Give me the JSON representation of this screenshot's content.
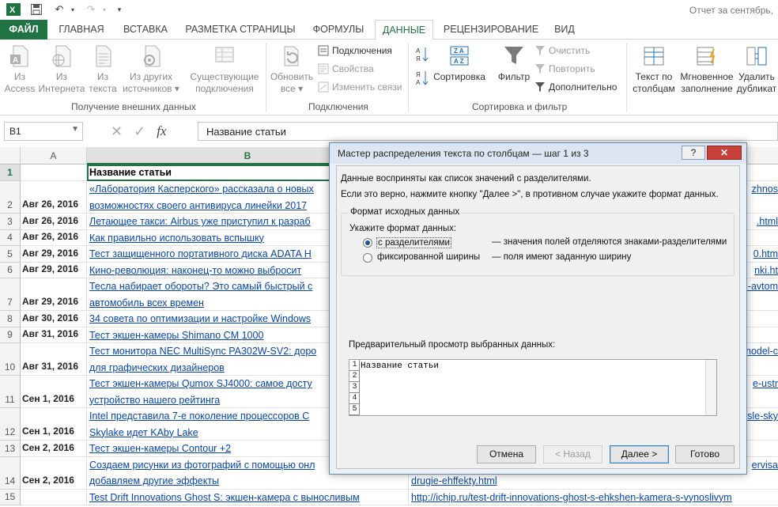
{
  "title_bar": {
    "doc_title": "Отчет за сентябрь,"
  },
  "tabs": [
    {
      "label": "ФАЙЛ"
    },
    {
      "label": "ГЛАВНАЯ"
    },
    {
      "label": "ВСТАВКА"
    },
    {
      "label": "РАЗМЕТКА СТРАНИЦЫ"
    },
    {
      "label": "ФОРМУЛЫ"
    },
    {
      "label": "ДАННЫЕ"
    },
    {
      "label": "РЕЦЕНЗИРОВАНИЕ"
    },
    {
      "label": "ВИД"
    }
  ],
  "ribbon": {
    "external": {
      "access": [
        "Из",
        "Access"
      ],
      "web": [
        "Из",
        "Интернета"
      ],
      "text": [
        "Из",
        "текста"
      ],
      "other": [
        "Из других",
        "источников ▾"
      ],
      "existing": [
        "Существующие",
        "подключения"
      ],
      "group_label": "Получение внешних данных"
    },
    "connections": {
      "refresh": [
        "Обновить",
        "все ▾"
      ],
      "conn": "Подключения",
      "props": "Свойства",
      "edit_links": "Изменить связи",
      "group_label": "Подключения"
    },
    "sort_filter": {
      "sort": "Сортировка",
      "filter": "Фильтр",
      "clear": "Очистить",
      "reapply": "Повторить",
      "advanced": "Дополнительно",
      "group_label": "Сортировка и фильтр"
    },
    "tools": {
      "text_to_cols": [
        "Текст по",
        "столбцам"
      ],
      "flash_fill": [
        "Мгновенное",
        "заполнение"
      ],
      "remove_dup": [
        "Удалить",
        "дубликат"
      ]
    }
  },
  "formula_bar": {
    "name_box": "B1",
    "fx": "fx",
    "content": "Название статьи"
  },
  "grid": {
    "columns": [
      "A",
      "B"
    ],
    "rows": [
      {
        "num": "1",
        "date": "",
        "title": [
          "Название статьи"
        ],
        "url": [
          ""
        ]
      },
      {
        "num": "2",
        "date": "Авг 26, 2016",
        "title": [
          "«Лаборатория Касперского» рассказала о новых",
          "возможностях своего антивируса линейки 2017"
        ],
        "url": [
          "zhnos",
          ""
        ]
      },
      {
        "num": "3",
        "date": "Авг 26, 2016",
        "title": [
          "Летающее такси: Airbus уже приступил к разраб"
        ],
        "url": [
          ".html"
        ]
      },
      {
        "num": "4",
        "date": "Авг 26, 2016",
        "title": [
          "Как правильно использовать вспышку"
        ],
        "url": [
          ""
        ]
      },
      {
        "num": "5",
        "date": "Авг 29, 2016",
        "title": [
          "Тест защищенного портативного диска ADATA H"
        ],
        "url": [
          "0.htm"
        ]
      },
      {
        "num": "6",
        "date": "Авг 29, 2016",
        "title": [
          "Кино-революция: наконец-то можно выбросит"
        ],
        "url": [
          "nki.ht"
        ]
      },
      {
        "num": "7",
        "date": "Авг 29, 2016",
        "title": [
          "Тесла набирает обороты? Это самый быстрый с",
          "автомобиль всех времен"
        ],
        "url": [
          "ki-avtom",
          ""
        ]
      },
      {
        "num": "8",
        "date": "Авг 30, 2016",
        "title": [
          "34 совета по оптимизации и настройке Windows"
        ],
        "url": [
          ""
        ]
      },
      {
        "num": "9",
        "date": "Авг 31, 2016",
        "title": [
          "Тест экшен-камеры Shimano CM 1000"
        ],
        "url": [
          ""
        ]
      },
      {
        "num": "10",
        "date": "Авг 31, 2016",
        "title": [
          "Тест монитора NEC MultiSync PA302W-SV2: доро",
          "для графических дизайнеров"
        ],
        "url": [
          "model-c",
          ""
        ]
      },
      {
        "num": "11",
        "date": "Сен 1, 2016",
        "title": [
          "Тест экшен-камеры Qumox SJ4000: самое досту",
          "устройство нашего рейтинга"
        ],
        "url": [
          "e-ustr",
          ""
        ]
      },
      {
        "num": "12",
        "date": "Сен 1, 2016",
        "title": [
          "Intel представила 7-е поколение процессоров С",
          "Skylake идет KAby Lake"
        ],
        "url": [
          "sle-sky",
          ""
        ]
      },
      {
        "num": "13",
        "date": "Сен 2, 2016",
        "title": [
          "Тест экшен-камеры Contour +2"
        ],
        "url": [
          ""
        ]
      },
      {
        "num": "14",
        "date": "Сен 2, 2016",
        "title": [
          "Создаем рисунки из фотографий с помощью онл",
          "добавляем другие эффекты"
        ],
        "url": [
          "ervisa",
          "drugie-ehffekty.html"
        ]
      },
      {
        "num": "15",
        "date": "",
        "title": [
          "Test Drift Innovations Ghost S: экшен-камера с выносливым"
        ],
        "url": [
          "http://ichip.ru/test-drift-innovations-ghost-s-ehkshen-kamera-s-vynoslivym"
        ]
      }
    ]
  },
  "dialog": {
    "title": "Мастер распределения текста по столбцам — шаг 1 из 3",
    "help": "?",
    "close": "✕",
    "line1": "Данные восприняты как список значений с разделителями.",
    "line2": "Если это верно, нажмите кнопку \"Далее >\", в противном случае укажите формат данных.",
    "group_title": "Формат исходных данных",
    "prompt": "Укажите формат данных:",
    "option1": "с разделителями",
    "option1_desc": "— значения полей отделяются знаками-разделителями",
    "option2": "фиксированной ширины",
    "option2_desc": "— поля имеют заданную ширину",
    "preview_label": "Предварительный просмотр выбранных данных:",
    "preview_lines": [
      "1",
      "2",
      "3",
      "4",
      "5"
    ],
    "preview_first": "Название статьи",
    "buttons": {
      "cancel": "Отмена",
      "back": "< Назад",
      "next": "Далее >",
      "finish": "Готово"
    }
  }
}
